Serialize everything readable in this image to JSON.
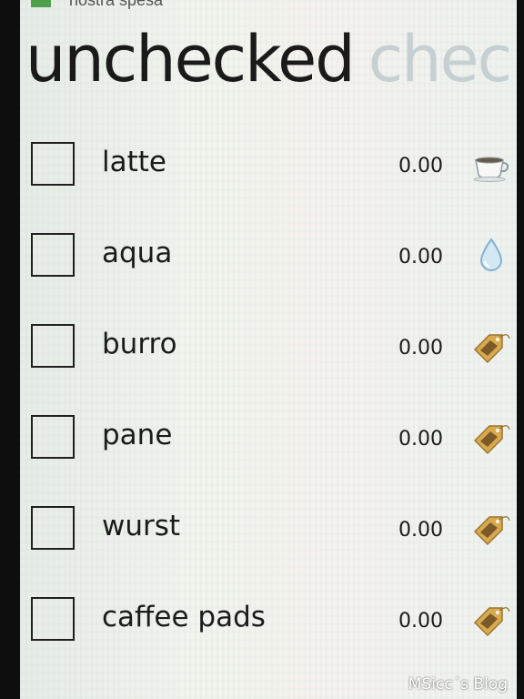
{
  "app": {
    "title": "nostra spesa"
  },
  "pivot": {
    "active": "unchecked",
    "inactive": "chec"
  },
  "items": [
    {
      "name": "latte",
      "price": "0.00",
      "icon": "coffee-cup-icon"
    },
    {
      "name": "aqua",
      "price": "0.00",
      "icon": "water-drop-icon"
    },
    {
      "name": "burro",
      "price": "0.00",
      "icon": "price-tag-icon"
    },
    {
      "name": "pane",
      "price": "0.00",
      "icon": "price-tag-icon"
    },
    {
      "name": "wurst",
      "price": "0.00",
      "icon": "price-tag-icon"
    },
    {
      "name": "caffee pads",
      "price": "0.00",
      "icon": "price-tag-icon"
    }
  ],
  "watermark": "MSicc´s Blog",
  "colors": {
    "background": "#eef2ee",
    "text": "#1b1b1b",
    "inactive_header": "#c6d0d3",
    "app_icon": "#4fa04a",
    "tag": "#d9a94e",
    "drop": "#9fc7dd"
  }
}
